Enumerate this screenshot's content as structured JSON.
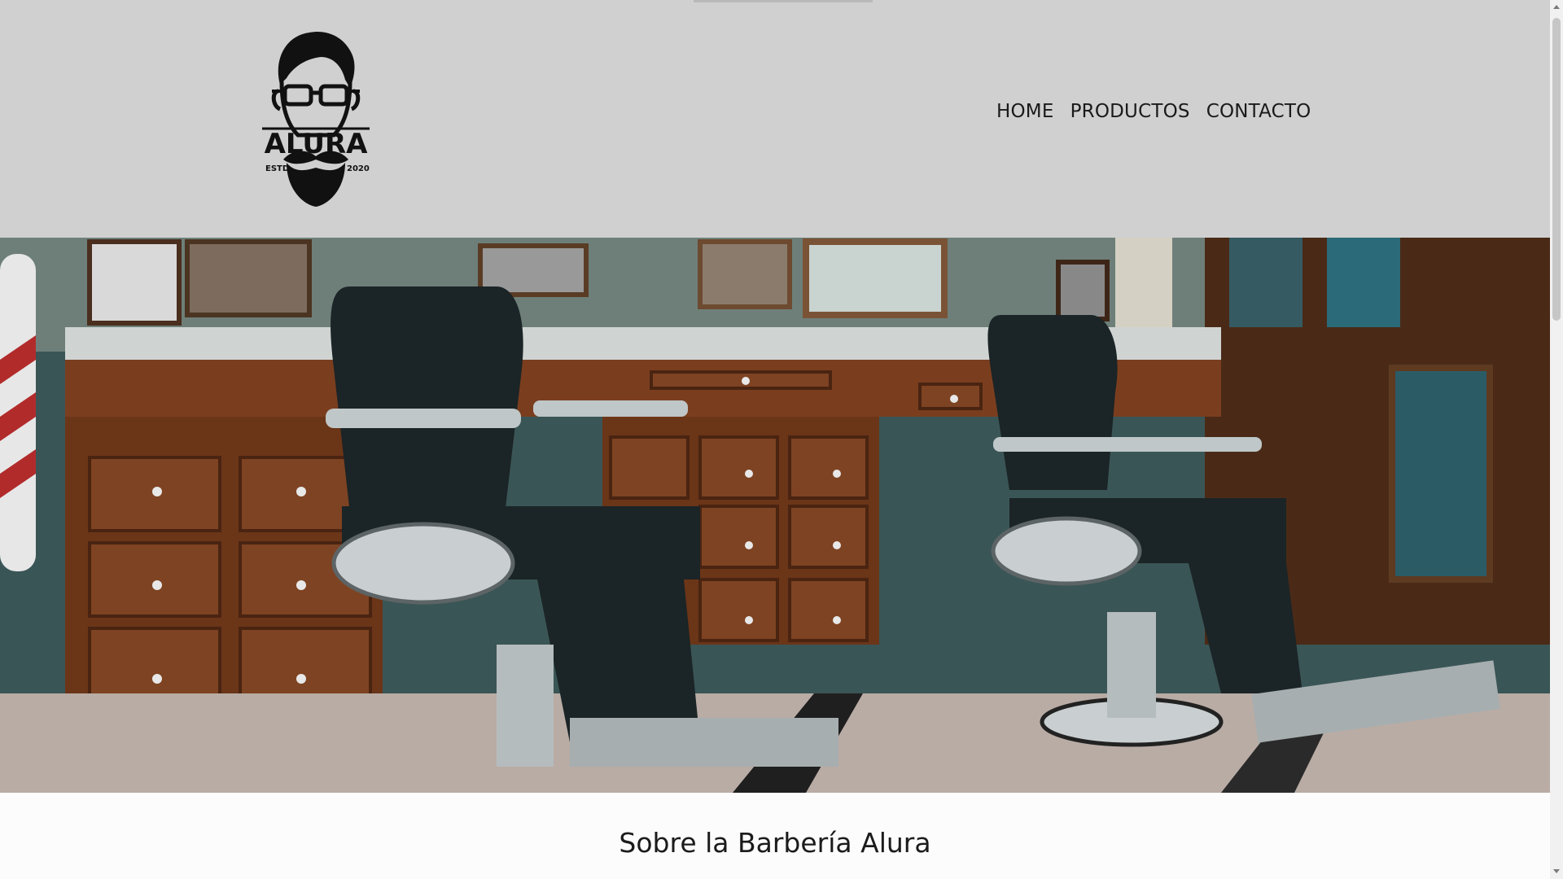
{
  "brand": {
    "logo_text": "ALURA",
    "logo_left": "ESTD",
    "logo_right": "2020"
  },
  "nav": {
    "items": [
      "HOME",
      "PRODUCTOS",
      "CONTACTO"
    ]
  },
  "hero": {
    "image_description_icon": "barbershop-photo"
  },
  "about": {
    "title": "Sobre la Barbería Alura"
  },
  "colors": {
    "header_bg": "#d0d0d0",
    "page_bg": "#fcfcfc",
    "text": "#1b1b1b"
  }
}
